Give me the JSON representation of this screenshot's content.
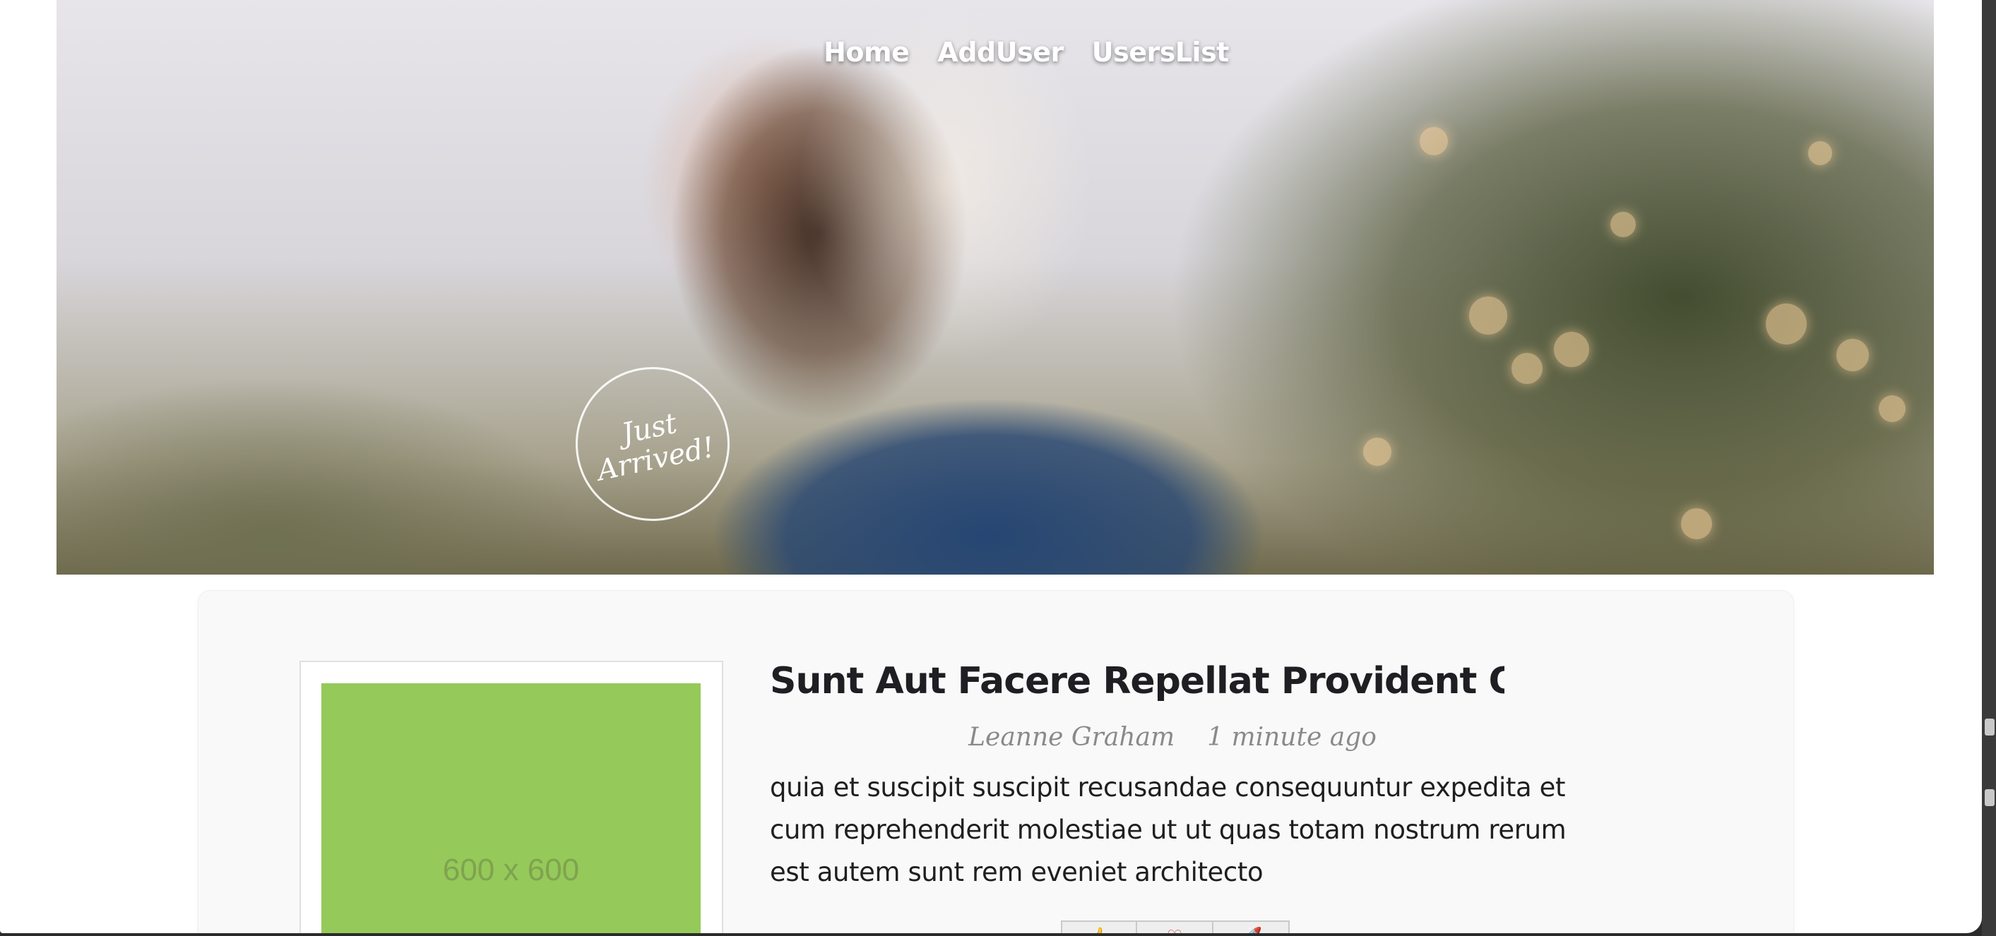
{
  "nav": {
    "items": [
      {
        "label": "Home"
      },
      {
        "label": "AddUser"
      },
      {
        "label": "UsersList"
      }
    ]
  },
  "hero": {
    "badge_text": "Just\nArrived!"
  },
  "post": {
    "thumbnail_label": "600 x 600",
    "thumbnail_color": "#95c95a",
    "title": "Sunt Aut Facere Repellat Provident Occaecati Excepturi Optio Reprehenderit",
    "author": "Leanne Graham",
    "time": "1 minute ago",
    "excerpt": "quia et suscipit suscipit recusandae consequuntur expedita et cum reprehenderit molestiae ut ut quas totam nostrum rerum est autem sunt rem eveniet architecto",
    "reactions": [
      {
        "icon": "thumbs-up-icon",
        "glyph": "👍"
      },
      {
        "icon": "heart-icon",
        "glyph": "♡"
      },
      {
        "icon": "rocket-icon",
        "glyph": "🚀"
      }
    ]
  }
}
